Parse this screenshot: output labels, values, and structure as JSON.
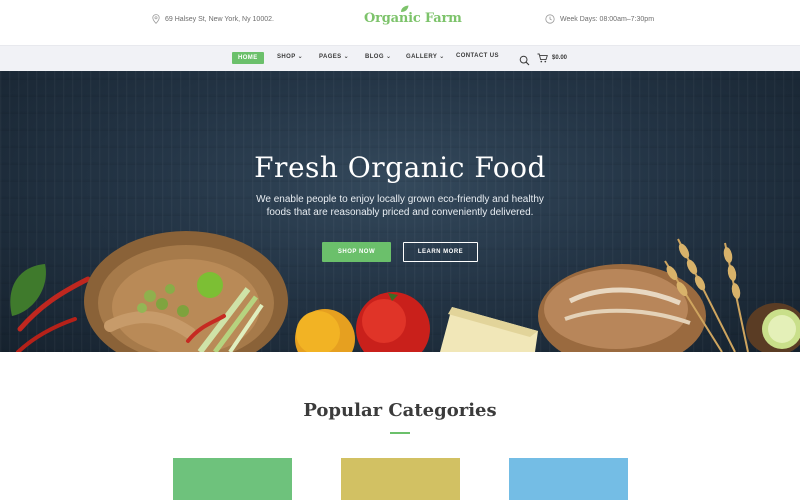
{
  "topbar": {
    "address": "69 Halsey St, New York, Ny 10002.",
    "logo": "Organic Farm",
    "hours": "Week Days: 08:00am–7:30pm"
  },
  "nav": {
    "items": [
      {
        "label": "HOME",
        "active": true,
        "dropdown": false
      },
      {
        "label": "SHOP",
        "active": false,
        "dropdown": true
      },
      {
        "label": "PAGES",
        "active": false,
        "dropdown": true
      },
      {
        "label": "BLOG",
        "active": false,
        "dropdown": true
      },
      {
        "label": "GALLERY",
        "active": false,
        "dropdown": true
      },
      {
        "label": "CONTACT US",
        "active": false,
        "dropdown": false
      }
    ],
    "cart_total": "$0.00"
  },
  "hero": {
    "title": "Fresh Organic Food",
    "subtitle": "We enable people to enjoy locally grown eco-friendly and healthy foods that are reasonably priced and conveniently delivered.",
    "shop_button": "SHOP NOW",
    "learn_button": "LEARN MORE"
  },
  "categories": {
    "title": "Popular Categories",
    "cards": [
      {
        "color": "#6ec27c"
      },
      {
        "color": "#d2c163"
      },
      {
        "color": "#74bde5"
      }
    ]
  },
  "colors": {
    "accent": "#6bc06b",
    "nav_bg": "#f1f2f6",
    "hero_bg": "#243546"
  }
}
